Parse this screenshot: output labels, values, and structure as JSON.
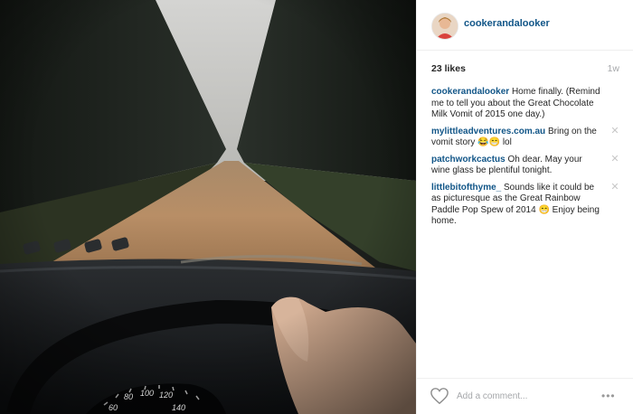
{
  "post": {
    "username": "cookerandalooker",
    "likes": "23 likes",
    "time": "1w"
  },
  "photo": {
    "description_icon": "road-through-forest-photo"
  },
  "comments": [
    {
      "user": "cookerandalooker",
      "text": "Home finally. (Remind me to tell you about the Great Chocolate Milk Vomit of 2015 one day.)",
      "deletable": false
    },
    {
      "user": "mylittleadventures.com.au",
      "text": "Bring on the vomit story",
      "emoji": "😂😁",
      "text_after": "lol",
      "deletable": true
    },
    {
      "user": "patchworkcactus",
      "text": "Oh dear. May your wine glass be plentiful tonight.",
      "deletable": true
    },
    {
      "user": "littlebitofthyme_",
      "text": "Sounds like it could be as picturesque as the Great Rainbow Paddle Pop Spew of 2014",
      "emoji": "😁",
      "text_after": "Enjoy being home.",
      "deletable": true
    }
  ],
  "comment_bar": {
    "placeholder": "Add a comment...",
    "more_label": "•••"
  },
  "colors": {
    "username": "#125688",
    "muted": "#a5a7aa"
  }
}
